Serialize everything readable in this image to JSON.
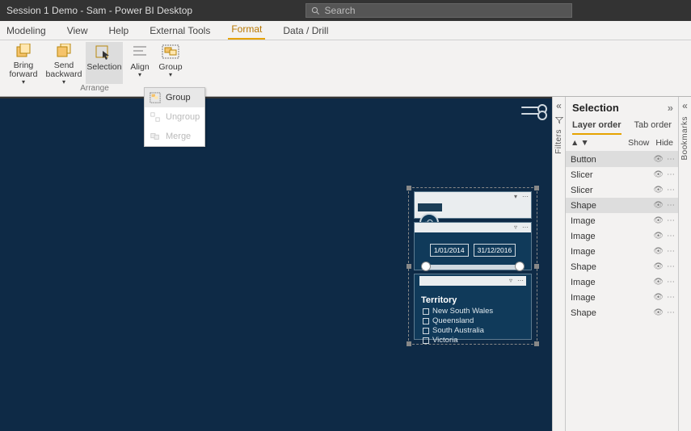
{
  "titlebar": {
    "title": "Session 1 Demo - Sam - Power BI Desktop",
    "search_placeholder": "Search"
  },
  "tabs": [
    "Modeling",
    "View",
    "Help",
    "External Tools",
    "Format",
    "Data / Drill"
  ],
  "active_tab": "Format",
  "ribbon": {
    "group_label": "Arrange",
    "buttons": {
      "bring_forward": "Bring forward",
      "send_backward": "Send backward",
      "selection": "Selection",
      "align": "Align",
      "group": "Group"
    }
  },
  "group_menu": {
    "group": "Group",
    "ungroup": "Ungroup",
    "merge": "Merge"
  },
  "rails": {
    "filters": "Filters",
    "bookmarks": "Bookmarks"
  },
  "selection_pane": {
    "title": "Selection",
    "layer_tab": "Layer order",
    "tab_order_tab": "Tab order",
    "show": "Show",
    "hide": "Hide",
    "items": [
      {
        "name": "Button",
        "selected": true
      },
      {
        "name": "Slicer",
        "selected": false
      },
      {
        "name": "Slicer",
        "selected": false
      },
      {
        "name": "Shape",
        "selected": true
      },
      {
        "name": "Image",
        "selected": false
      },
      {
        "name": "Image",
        "selected": false
      },
      {
        "name": "Image",
        "selected": false
      },
      {
        "name": "Shape",
        "selected": false
      },
      {
        "name": "Image",
        "selected": false
      },
      {
        "name": "Image",
        "selected": false
      },
      {
        "name": "Shape",
        "selected": false
      }
    ]
  },
  "canvas": {
    "slicer_dates": {
      "from": "1/01/2014",
      "to": "31/12/2016"
    },
    "territory": {
      "title": "Territory",
      "options": [
        "New South Wales",
        "Queensland",
        "South Australia",
        "Victoria"
      ]
    }
  }
}
